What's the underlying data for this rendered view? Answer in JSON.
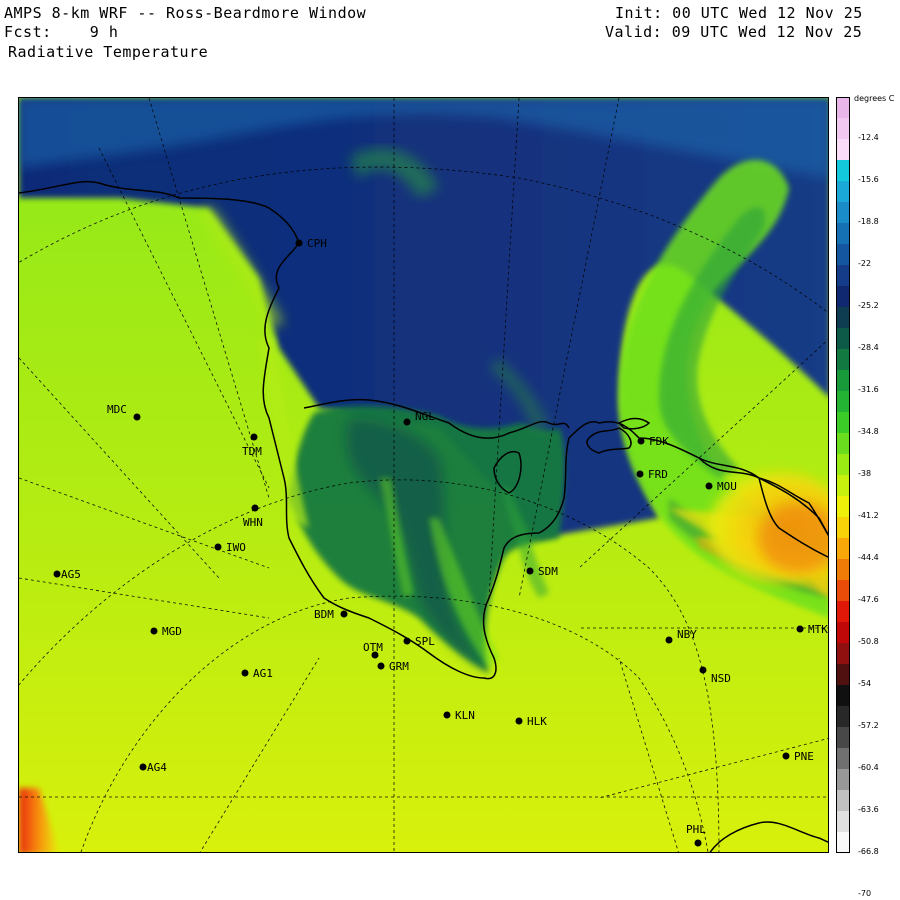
{
  "header": {
    "title": "AMPS 8-km WRF -- Ross-Beardmore Window",
    "forecast": "Fcst:    9 h",
    "field": "Radiative Temperature",
    "init": "Init: 00 UTC Wed 12 Nov 25",
    "valid": "Valid: 09 UTC Wed 12 Nov 25"
  },
  "legend": {
    "units": "degrees C",
    "colors": [
      "#e8b6e8",
      "#f0c8f0",
      "#f8dcf8",
      "#14c8dc",
      "#1aa8d8",
      "#1a8cc8",
      "#1670b4",
      "#1456a0",
      "#143c88",
      "#102870",
      "#0e3c50",
      "#0e5a48",
      "#127a40",
      "#189a3a",
      "#22b432",
      "#3ccc28",
      "#6ade1e",
      "#9aea14",
      "#c8f00e",
      "#eef00a",
      "#f8d208",
      "#f8a808",
      "#f07c08",
      "#e84c08",
      "#e01808",
      "#c00808",
      "#901010",
      "#501010",
      "#101010",
      "#282828",
      "#484848",
      "#707070",
      "#989898",
      "#c0c0c0",
      "#e0e0e0",
      "#f8f8f8"
    ],
    "labels": [
      "-12.4",
      "-15.6",
      "-18.8",
      "-22",
      "-25.2",
      "-28.4",
      "-31.6",
      "-34.8",
      "-38",
      "-41.2",
      "-44.4",
      "-47.6",
      "-50.8",
      "-54",
      "-57.2",
      "-60.4",
      "-63.6",
      "-66.8",
      "-70"
    ]
  },
  "stations": [
    {
      "id": "CPH",
      "label": "CPH"
    },
    {
      "id": "NGL",
      "label": "NGL"
    },
    {
      "id": "MDC",
      "label": "MDC"
    },
    {
      "id": "TDM",
      "label": "TDM"
    },
    {
      "id": "FDK",
      "label": "FDK"
    },
    {
      "id": "FRD",
      "label": "FRD"
    },
    {
      "id": "MOU",
      "label": "MOU"
    },
    {
      "id": "WHN",
      "label": "WHN"
    },
    {
      "id": "IWO",
      "label": "IWO"
    },
    {
      "id": "AG5",
      "label": "AG5"
    },
    {
      "id": "SDM",
      "label": "SDM"
    },
    {
      "id": "BDM",
      "label": "BDM"
    },
    {
      "id": "MGD",
      "label": "MGD"
    },
    {
      "id": "NBY",
      "label": "NBY"
    },
    {
      "id": "MTK",
      "label": "MTK"
    },
    {
      "id": "SPL",
      "label": "SPL"
    },
    {
      "id": "OTM",
      "label": "OTM"
    },
    {
      "id": "GRM",
      "label": "GRM"
    },
    {
      "id": "AG1",
      "label": "AG1"
    },
    {
      "id": "NSD",
      "label": "NSD"
    },
    {
      "id": "KLN",
      "label": "KLN"
    },
    {
      "id": "HLK",
      "label": "HLK"
    },
    {
      "id": "AG4",
      "label": "AG4"
    },
    {
      "id": "PNE",
      "label": "PNE"
    },
    {
      "id": "PHL",
      "label": "PHL"
    }
  ]
}
